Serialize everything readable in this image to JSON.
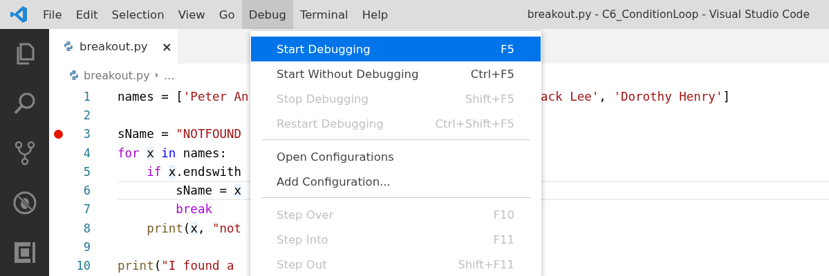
{
  "menubar": [
    {
      "label": "File",
      "selected": false
    },
    {
      "label": "Edit",
      "selected": false
    },
    {
      "label": "Selection",
      "selected": false
    },
    {
      "label": "View",
      "selected": false
    },
    {
      "label": "Go",
      "selected": false
    },
    {
      "label": "Debug",
      "selected": true
    },
    {
      "label": "Terminal",
      "selected": false
    },
    {
      "label": "Help",
      "selected": false
    }
  ],
  "window": {
    "title": "breakout.py - C6_ConditionLoop - Visual Studio Code"
  },
  "tabs": [
    {
      "label": "breakout.py",
      "selected": true,
      "close": "×"
    }
  ],
  "breadcrumbs": {
    "file": "breakout.py",
    "more": "…"
  },
  "editor": {
    "lines": [
      {
        "number": "1",
        "breakpoint": false,
        "current": false,
        "spans": [
          {
            "kind": "plain",
            "text": "names = ["
          },
          {
            "kind": "string",
            "text": "'Peter An"
          }
        ],
        "right_spans": [
          {
            "kind": "string",
            "text": "ack Lee'"
          },
          {
            "kind": "plain",
            "text": ", "
          },
          {
            "kind": "string",
            "text": "'Dorothy Henry'"
          },
          {
            "kind": "plain",
            "text": "]"
          }
        ]
      },
      {
        "number": "2",
        "breakpoint": false,
        "current": false
      },
      {
        "number": "3",
        "breakpoint": true,
        "current": false,
        "spans": [
          {
            "kind": "plain",
            "text": "sName = "
          },
          {
            "kind": "string",
            "text": "\"NOTFOUND"
          }
        ]
      },
      {
        "number": "4",
        "breakpoint": false,
        "current": false,
        "spans": [
          {
            "kind": "control",
            "text": "for "
          },
          {
            "kind": "plain",
            "text": "x",
            "highlight": true
          },
          {
            "kind": "keyword",
            "text": " in"
          },
          {
            "kind": "plain",
            "text": " names:"
          }
        ]
      },
      {
        "number": "5",
        "breakpoint": false,
        "current": false,
        "spans": [
          {
            "kind": "control",
            "text": "    if "
          },
          {
            "kind": "plain",
            "text": "x",
            "highlight": true
          },
          {
            "kind": "plain",
            "text": ".endswith"
          }
        ]
      },
      {
        "number": "6",
        "breakpoint": false,
        "current": true,
        "spans": [
          {
            "kind": "plain",
            "text": "        sName = "
          },
          {
            "kind": "plain",
            "text": "x",
            "highlight": true
          }
        ]
      },
      {
        "number": "7",
        "breakpoint": false,
        "current": false,
        "spans": [
          {
            "kind": "control",
            "text": "        break"
          }
        ]
      },
      {
        "number": "8",
        "breakpoint": false,
        "current": false,
        "spans": [
          {
            "kind": "function",
            "text": "    print"
          },
          {
            "kind": "plain",
            "text": "("
          },
          {
            "kind": "plain",
            "text": "x",
            "highlight": true
          },
          {
            "kind": "plain",
            "text": ", "
          },
          {
            "kind": "string",
            "text": "\"not"
          }
        ]
      },
      {
        "number": "9",
        "breakpoint": false,
        "current": false
      },
      {
        "number": "10",
        "breakpoint": false,
        "current": false,
        "spans": [
          {
            "kind": "function",
            "text": "print"
          },
          {
            "kind": "plain",
            "text": "("
          },
          {
            "kind": "string",
            "text": "\"I found a"
          }
        ]
      }
    ]
  },
  "debug_menu": [
    {
      "kind": "item",
      "label": "Start Debugging",
      "shortcut": "F5",
      "selected": true,
      "disabled": false
    },
    {
      "kind": "item",
      "label": "Start Without Debugging",
      "shortcut": "Ctrl+F5",
      "selected": false,
      "disabled": false
    },
    {
      "kind": "item",
      "label": "Stop Debugging",
      "shortcut": "Shift+F5",
      "selected": false,
      "disabled": true
    },
    {
      "kind": "item",
      "label": "Restart Debugging",
      "shortcut": "Ctrl+Shift+F5",
      "selected": false,
      "disabled": true
    },
    {
      "kind": "separator"
    },
    {
      "kind": "item",
      "label": "Open Configurations",
      "selected": false,
      "disabled": false
    },
    {
      "kind": "item",
      "label": "Add Configuration...",
      "selected": false,
      "disabled": false
    },
    {
      "kind": "separator"
    },
    {
      "kind": "item",
      "label": "Step Over",
      "shortcut": "F10",
      "selected": false,
      "disabled": true
    },
    {
      "kind": "item",
      "label": "Step Into",
      "shortcut": "F11",
      "selected": false,
      "disabled": true
    },
    {
      "kind": "item",
      "label": "Step Out",
      "shortcut": "Shift+F11",
      "selected": false,
      "disabled": true
    }
  ]
}
